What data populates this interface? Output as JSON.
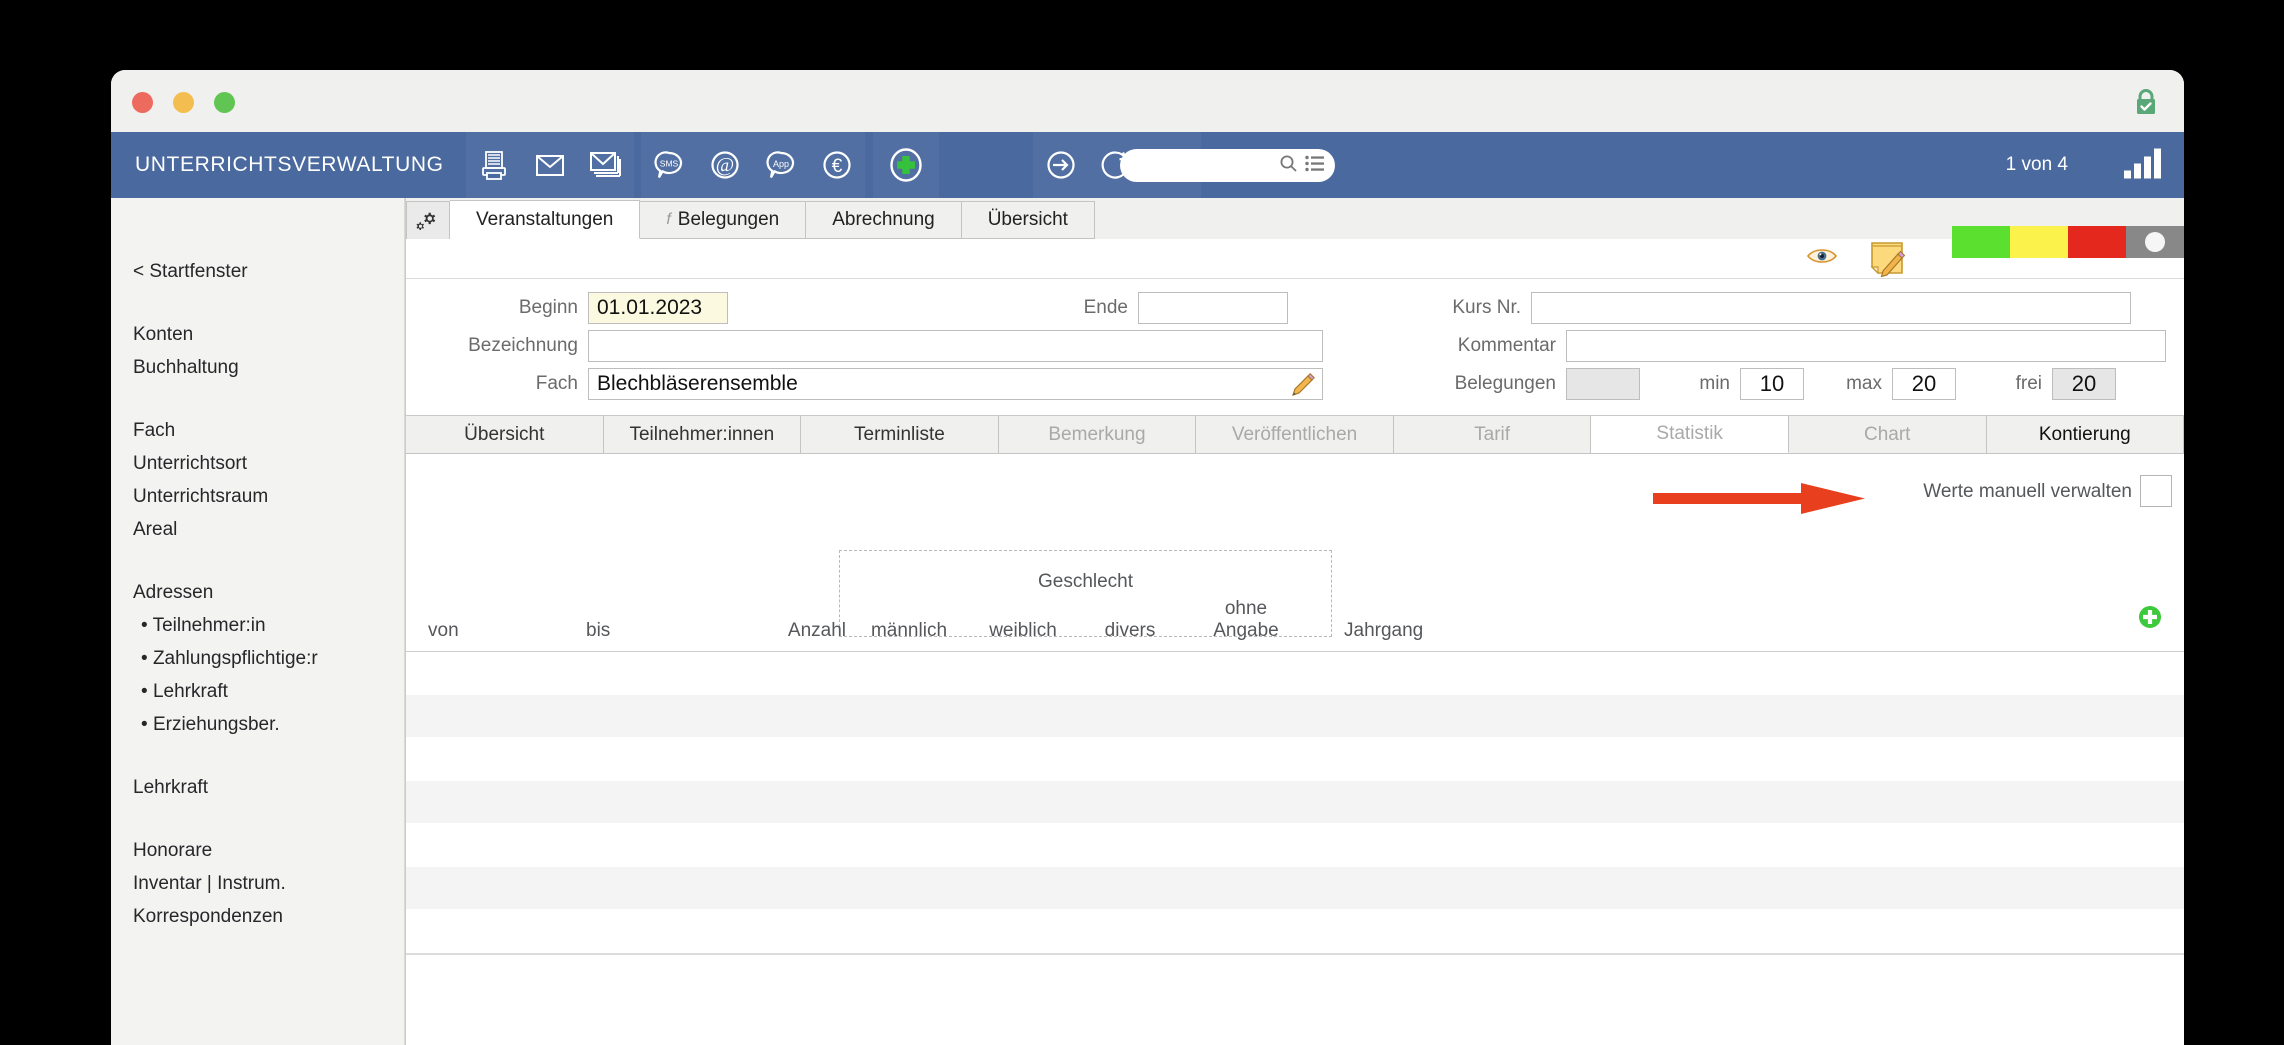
{
  "window": {
    "traffic_lights": [
      "close",
      "minimize",
      "zoom"
    ],
    "lock_icon": "lock-secure-icon"
  },
  "toolbar": {
    "app_title": "UNTERRICHTSVERWALTUNG",
    "icons_left": [
      {
        "name": "print-icon",
        "label": "Drucken"
      },
      {
        "name": "mail-icon",
        "label": "E-Mail"
      },
      {
        "name": "mail-stack-icon",
        "label": "Serienmail"
      }
    ],
    "icons_mid": [
      {
        "name": "sms-icon",
        "label": "SMS"
      },
      {
        "name": "at-icon",
        "label": "@"
      },
      {
        "name": "app-icon",
        "label": "App"
      },
      {
        "name": "euro-icon",
        "label": "€"
      }
    ],
    "icons_add": [
      {
        "name": "plus-circle-icon",
        "label": "Neu"
      }
    ],
    "icons_right": [
      {
        "name": "arrow-right-circle-icon",
        "label": "Gehe zu"
      },
      {
        "name": "refresh-circle-icon",
        "label": "Aktualisieren"
      },
      {
        "name": "search-circle-icon",
        "label": "Suchen"
      }
    ],
    "search": {
      "value": "",
      "placeholder": ""
    },
    "search_icon": "magnifier-icon",
    "list_icon": "list-icon",
    "pager": "1 von 4",
    "chart_icon": "bar-chart-icon",
    "accent_color": "#4a699f"
  },
  "sidebar": {
    "back_link": "< Startfenster",
    "groups": [
      {
        "items": [
          {
            "label": "Konten",
            "type": "item"
          },
          {
            "label": "Buchhaltung",
            "type": "item"
          }
        ]
      },
      {
        "items": [
          {
            "label": "Fach",
            "type": "item"
          },
          {
            "label": "Unterrichtsort",
            "type": "item"
          },
          {
            "label": "Unterrichtsraum",
            "type": "item"
          },
          {
            "label": "Areal",
            "type": "item"
          }
        ]
      },
      {
        "items": [
          {
            "label": "Adressen",
            "type": "item"
          },
          {
            "label": "Teilnehmer:in",
            "type": "sub"
          },
          {
            "label": "Zahlungspflichtige:r",
            "type": "sub"
          },
          {
            "label": "Lehrkraft",
            "type": "sub"
          },
          {
            "label": "Erziehungsber.",
            "type": "sub"
          }
        ]
      },
      {
        "items": [
          {
            "label": "Lehrkraft",
            "type": "item"
          }
        ]
      },
      {
        "items": [
          {
            "label": "Honorare",
            "type": "item"
          },
          {
            "label": "Inventar | Instrum.",
            "type": "item"
          },
          {
            "label": "Korrespondenzen",
            "type": "item"
          }
        ]
      }
    ]
  },
  "top_tabs": {
    "gear_icon": "gear-icon",
    "items": [
      {
        "label": "Veranstaltungen",
        "active": true,
        "glyph": ""
      },
      {
        "label": "Belegungen",
        "active": false,
        "glyph": "f"
      },
      {
        "label": "Abrechnung",
        "active": false,
        "glyph": ""
      },
      {
        "label": "Übersicht",
        "active": false,
        "glyph": ""
      }
    ]
  },
  "head_strip": {
    "eye_icon": "eye-icon",
    "note_icon": "note-edit-icon",
    "status_colors": [
      "#5ce02f",
      "#fbf24c",
      "#e4281d",
      "#888888"
    ]
  },
  "form": {
    "left": [
      {
        "label": "Beginn",
        "value": "01.01.2023",
        "style": "highlight"
      },
      {
        "label": "Bezeichnung",
        "value": "",
        "style": "plain"
      },
      {
        "label": "Fach",
        "value": "Blechbläserensemble",
        "style": "plain",
        "pencil": true
      }
    ],
    "mid": [
      {
        "label": "Ende",
        "value": ""
      }
    ],
    "right": [
      {
        "label": "Kurs Nr.",
        "value": ""
      },
      {
        "label": "Kommentar",
        "value": ""
      }
    ],
    "belegungen": {
      "label": "Belegungen",
      "count_value": "",
      "min_label": "min",
      "min_value": "10",
      "max_label": "max",
      "max_value": "20",
      "frei_label": "frei",
      "frei_value": "20"
    }
  },
  "sub_tabs": [
    {
      "label": "Übersicht",
      "state": "normal"
    },
    {
      "label": "Teilnehmer:innen",
      "state": "normal"
    },
    {
      "label": "Terminliste",
      "state": "normal"
    },
    {
      "label": "Bemerkung",
      "state": "dim"
    },
    {
      "label": "Veröffentlichen",
      "state": "dim"
    },
    {
      "label": "Tarif",
      "state": "dim"
    },
    {
      "label": "Statistik",
      "state": "active"
    },
    {
      "label": "Chart",
      "state": "dim"
    },
    {
      "label": "Kontierung",
      "state": "bold"
    }
  ],
  "manual_row": {
    "arrow_icon": "red-arrow-icon",
    "arrow_color": "#e8401f",
    "label": "Werte manuell verwalten",
    "checkbox_checked": false
  },
  "table": {
    "group_header": "Geschlecht",
    "columns": [
      {
        "key": "von",
        "label": "von"
      },
      {
        "key": "bis",
        "label": "bis"
      },
      {
        "key": "anzahl",
        "label": "Anzahl"
      },
      {
        "key": "maennlich",
        "label": "männlich"
      },
      {
        "key": "weiblich",
        "label": "weiblich"
      },
      {
        "key": "divers",
        "label": "divers"
      },
      {
        "key": "ohne",
        "label": "ohne\nAngabe",
        "line1": "ohne",
        "line2": "Angabe"
      },
      {
        "key": "jahrgang",
        "label": "Jahrgang"
      }
    ],
    "add_icon": "plus-circle-green-icon",
    "rows": []
  }
}
